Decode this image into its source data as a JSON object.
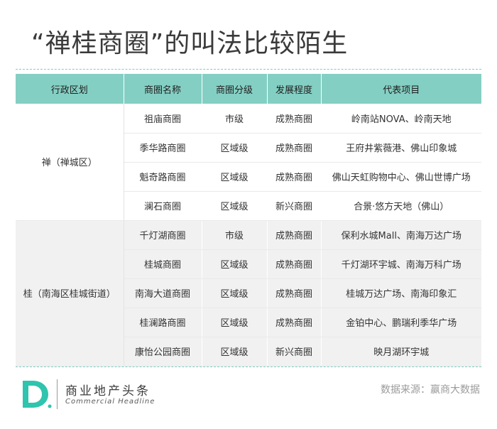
{
  "title": "“禅桂商圈”的叫法比较陌生",
  "table": {
    "headers": [
      "行政区划",
      "商圈名称",
      "商圈分级",
      "发展程度",
      "代表项目"
    ],
    "groups": [
      {
        "district": "禅（禅城区）",
        "rows": [
          [
            "祖庙商圈",
            "市级",
            "成熟商圈",
            "岭南站NOVA、岭南天地"
          ],
          [
            "季华路商圈",
            "区域级",
            "成熟商圈",
            "王府井紫薇港、佛山印象城"
          ],
          [
            "魁奇路商圈",
            "区域级",
            "成熟商圈",
            "佛山天虹购物中心、佛山世博广场"
          ],
          [
            "澜石商圈",
            "区域级",
            "新兴商圈",
            "合景·悠方天地（佛山）"
          ]
        ]
      },
      {
        "district": "桂（南海区桂城街道）",
        "rows": [
          [
            "千灯湖商圈",
            "市级",
            "成熟商圈",
            "保利水城Mall、南海万达广场"
          ],
          [
            "桂城商圈",
            "区域级",
            "成熟商圈",
            "千灯湖环宇城、南海万科广场"
          ],
          [
            "南海大道商圈",
            "区域级",
            "成熟商圈",
            "桂城万达广场、南海印象汇"
          ],
          [
            "桂澜路商圈",
            "区域级",
            "成熟商圈",
            "金铂中心、鹏瑞利季华广场"
          ],
          [
            "康怡公园商圈",
            "区域级",
            "新兴商圈",
            "映月湖环宇城"
          ]
        ]
      }
    ]
  },
  "footer": {
    "brand_cn": "商业地产头条",
    "brand_en": "Commercial Headline",
    "source": "数据来源：赢商大数据"
  },
  "colors": {
    "header_bg": "#84cfc3",
    "accent": "#2fc4ad",
    "group_alt_bg": "#f1f1f1"
  }
}
